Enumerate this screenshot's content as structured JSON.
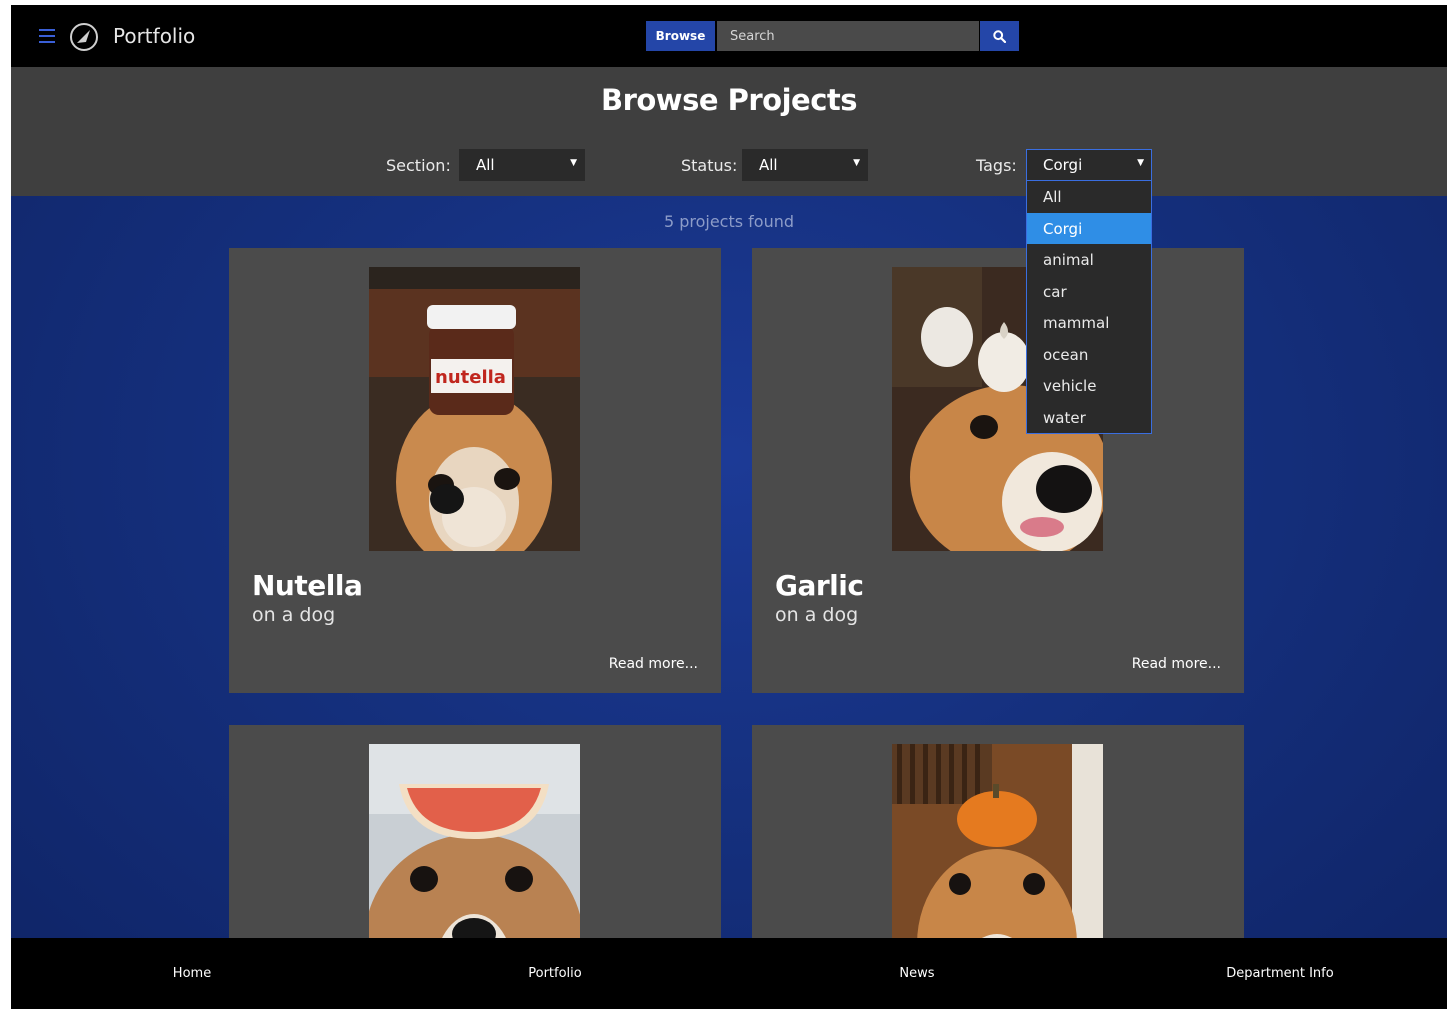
{
  "header": {
    "brand": "Portfolio",
    "browse_label": "Browse",
    "search_placeholder": "Search"
  },
  "page_title": "Browse Projects",
  "filters": {
    "section": {
      "label": "Section:",
      "value": "All"
    },
    "status": {
      "label": "Status:",
      "value": "All"
    },
    "tags": {
      "label": "Tags:",
      "value": "Corgi",
      "options": [
        "All",
        "Corgi",
        "animal",
        "car",
        "mammal",
        "ocean",
        "vehicle",
        "water"
      ],
      "selected_option": "Corgi"
    }
  },
  "results_count": "5 projects found",
  "projects": [
    {
      "title": "Nutella",
      "subtitle": "on a dog",
      "read_more": "Read more..."
    },
    {
      "title": "Garlic",
      "subtitle": "on a dog",
      "read_more": "Read more..."
    },
    {
      "title": "",
      "subtitle": "",
      "read_more": ""
    },
    {
      "title": "",
      "subtitle": "",
      "read_more": ""
    }
  ],
  "footer": {
    "links": [
      "Home",
      "Portfolio",
      "News",
      "Department Info"
    ]
  },
  "colors": {
    "accent": "#2446a8",
    "highlight": "#2f8ee6",
    "background": "#15307e",
    "panel": "#4b4b4b"
  },
  "icons": [
    "menu-icon",
    "logo-icon",
    "search-icon",
    "caret-down-icon"
  ]
}
